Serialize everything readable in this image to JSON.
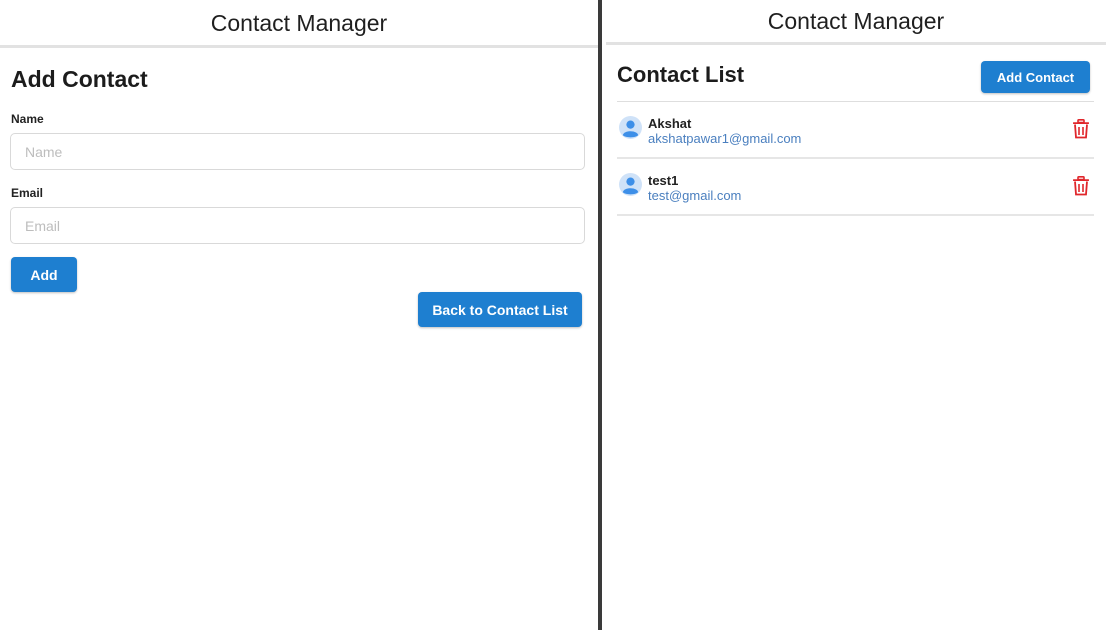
{
  "left": {
    "header_title": "Contact Manager",
    "form_title": "Add Contact",
    "name_label": "Name",
    "name_placeholder": "Name",
    "name_value": "",
    "email_label": "Email",
    "email_placeholder": "Email",
    "email_value": "",
    "add_label": "Add",
    "back_label": "Back to Contact List"
  },
  "right": {
    "header_title": "Contact Manager",
    "list_title": "Contact List",
    "add_contact_label": "Add Contact",
    "contacts": [
      {
        "name": "Akshat",
        "email": "akshatpawar1@gmail.com",
        "avatar_icon": "user-avatar-icon",
        "action_icon": "trash-icon"
      },
      {
        "name": "test1",
        "email": "test@gmail.com",
        "avatar_icon": "user-avatar-icon",
        "action_icon": "trash-icon"
      }
    ]
  },
  "colors": {
    "accent": "#1e7fd0",
    "delete": "#e0262b",
    "avatar_bg": "#cfe2f8",
    "avatar_fg": "#3d8fe8",
    "email_link": "#4a7fbf",
    "divider": "#3a3a3a"
  }
}
